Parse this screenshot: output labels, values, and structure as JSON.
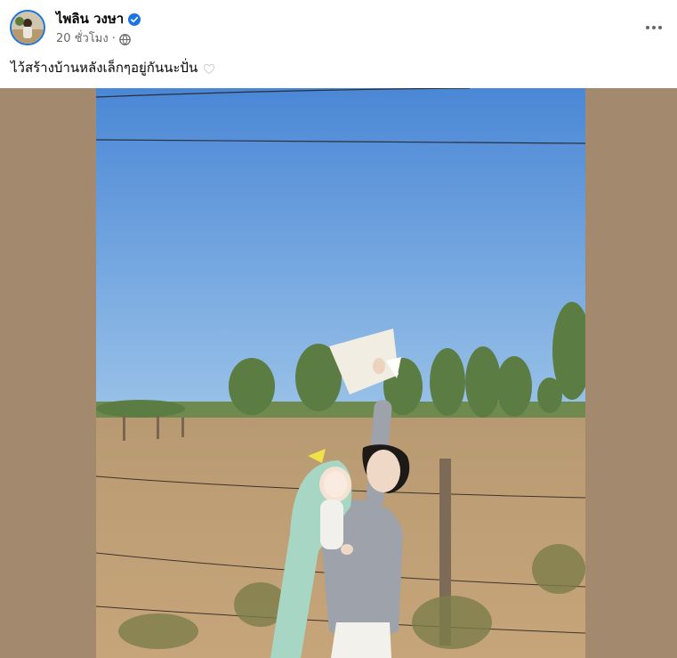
{
  "post": {
    "author_name": "ไพลิน วงษา",
    "timestamp": "20 ชั่วโมง",
    "separator": "·",
    "verified": true,
    "caption": "ไว้สร้างบ้านหลังเล็กๆอยู่กันนะปั่น"
  },
  "icons": {
    "verified": "verified-badge-icon",
    "privacy": "globe-icon",
    "more": "more-options-icon",
    "emoji": "white-heart-emoji-icon"
  },
  "colors": {
    "verified_badge": "#1b74e4",
    "media_background": "#a3896e",
    "sky_top": "#4a87d6",
    "sky_bottom": "#9bc3e8",
    "field": "#c7a57a"
  }
}
